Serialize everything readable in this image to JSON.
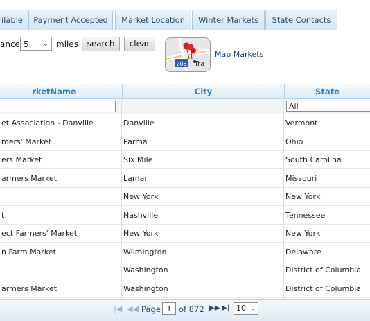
{
  "tabs": [
    {
      "label": "ilable"
    },
    {
      "label": "Payment Accepted"
    },
    {
      "label": "Market Location"
    },
    {
      "label": "Winter Markets"
    },
    {
      "label": "State Contacts"
    }
  ],
  "toolbar": {
    "distance_label": "ance:",
    "distance_value": "5",
    "miles_label": "miles",
    "search_label": "search",
    "clear_label": "clear",
    "map_link": "Map Markets",
    "map_icon_badge": "205",
    "map_icon_text": "Tra"
  },
  "grid": {
    "columns": [
      "rketName",
      "City",
      "State"
    ],
    "state_filter": "All",
    "rows": [
      {
        "name": "et Association - Danville",
        "city": "Danville",
        "state": "Vermont"
      },
      {
        "name": "mers' Market",
        "city": "Parma",
        "state": "Ohio"
      },
      {
        "name": "ers Market",
        "city": "Six Mile",
        "state": "South Carolina"
      },
      {
        "name": "armers Market",
        "city": "Lamar",
        "state": "Missouri"
      },
      {
        "name": "",
        "city": "New York",
        "state": "New York"
      },
      {
        "name": "t",
        "city": "Nashville",
        "state": "Tennessee"
      },
      {
        "name": "ect Farmers' Market",
        "city": "New York",
        "state": "New York"
      },
      {
        "name": "n Farm Market",
        "city": "Wilmington",
        "state": "Delaware"
      },
      {
        "name": "",
        "city": "Washington",
        "state": "District of Columbia"
      },
      {
        "name": "armers Market",
        "city": "Washington",
        "state": "District of Columbia"
      }
    ]
  },
  "pager": {
    "page_label": "Page",
    "current_page": "1",
    "of_label": "of 872",
    "page_size": "10"
  },
  "colors": {
    "header_text": "#2f7fbf",
    "tab_text": "#2a4c6b",
    "link": "#1a3a8a"
  }
}
